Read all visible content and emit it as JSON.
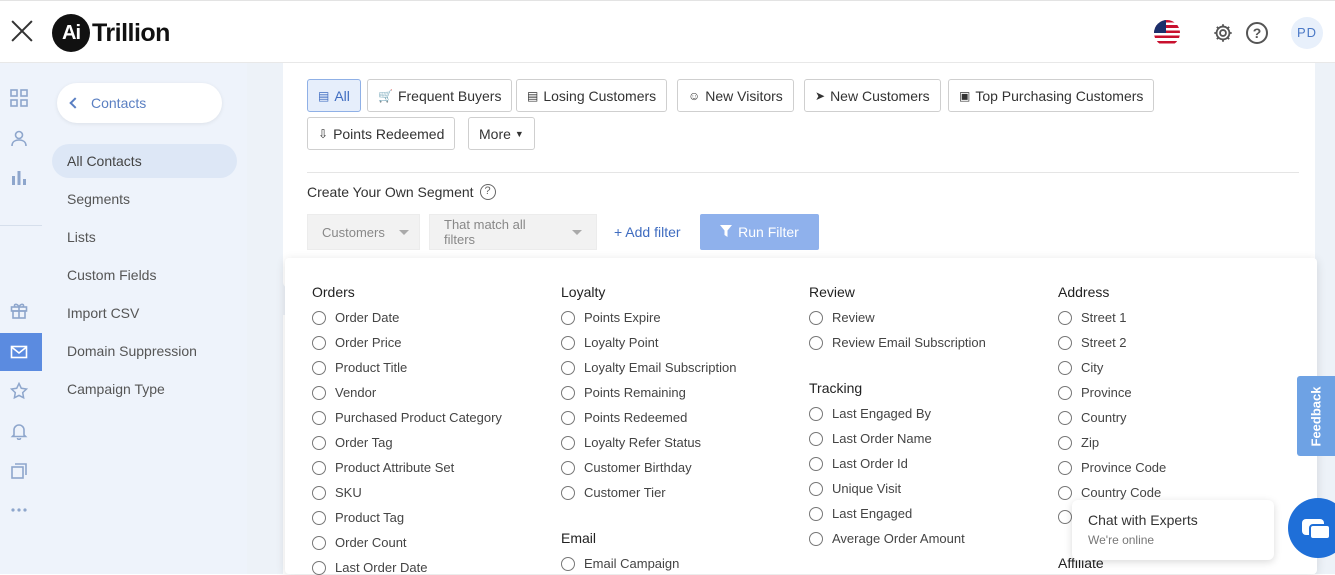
{
  "app": {
    "logo_badge": "Ai",
    "logo_text": "Trillion",
    "avatar_initials": "PD"
  },
  "sidebar": {
    "back_label": "Contacts",
    "items": [
      {
        "label": "All Contacts",
        "active": true
      },
      {
        "label": "Segments",
        "active": false
      },
      {
        "label": "Lists",
        "active": false
      },
      {
        "label": "Custom Fields",
        "active": false
      },
      {
        "label": "Import CSV",
        "active": false
      },
      {
        "label": "Domain Suppression",
        "active": false
      },
      {
        "label": "Campaign Type",
        "active": false
      }
    ]
  },
  "segments": {
    "buttons": [
      {
        "label": "All",
        "icon": "list-icon",
        "active": true
      },
      {
        "label": "Frequent Buyers",
        "icon": "cart-icon",
        "active": false
      },
      {
        "label": "Losing Customers",
        "icon": "list-alt-icon",
        "active": false
      },
      {
        "label": "New Visitors",
        "icon": "user-circle-icon",
        "active": false
      },
      {
        "label": "New Customers",
        "icon": "cursor-icon",
        "active": false
      },
      {
        "label": "Top Purchasing Customers",
        "icon": "credit-card-icon",
        "active": false
      },
      {
        "label": "Points Redeemed",
        "icon": "download-circle-icon",
        "active": false
      },
      {
        "label": "More",
        "icon": "caret-down-icon",
        "active": false
      }
    ]
  },
  "filter": {
    "heading": "Create Your Own Segment",
    "entity_select": "Customers",
    "match_select": "That match all filters",
    "add_filter_label": "+ Add filter",
    "run_filter_label": "Run Filter"
  },
  "filter_panel": {
    "groups": [
      {
        "title": "Orders",
        "options": [
          "Order Date",
          "Order Price",
          "Product Title",
          "Vendor",
          "Purchased Product Category",
          "Order Tag",
          "Product Attribute Set",
          "SKU",
          "Product Tag",
          "Order Count",
          "Last Order Date"
        ]
      },
      {
        "title": "Loyalty",
        "options": [
          "Points Expire",
          "Loyalty Point",
          "Loyalty Email Subscription",
          "Points Remaining",
          "Points Redeemed",
          "Loyalty Refer Status",
          "Customer Birthday",
          "Customer Tier"
        ]
      },
      {
        "title": "Email",
        "options": [
          "Email Campaign"
        ]
      },
      {
        "title": "Review",
        "options": [
          "Review",
          "Review Email Subscription"
        ]
      },
      {
        "title": "Tracking",
        "options": [
          "Last Engaged By",
          "Last Order Name",
          "Last Order Id",
          "Unique Visit",
          "Last Engaged",
          "Average Order Amount"
        ]
      },
      {
        "title": "Address",
        "options": [
          "Street 1",
          "Street 2",
          "City",
          "Province",
          "Country",
          "Zip",
          "Province Code",
          "Country Code"
        ]
      },
      {
        "title": "Affiliate",
        "options": []
      }
    ]
  },
  "feedback_label": "Feedback",
  "chat": {
    "title": "Chat with Experts",
    "status": "We're online"
  },
  "colors": {
    "accent": "#3f6cc0",
    "rail_bg": "#eef3fb",
    "run_filter_bg": "#8fb1ec",
    "chat_button": "#1f6fd8"
  }
}
